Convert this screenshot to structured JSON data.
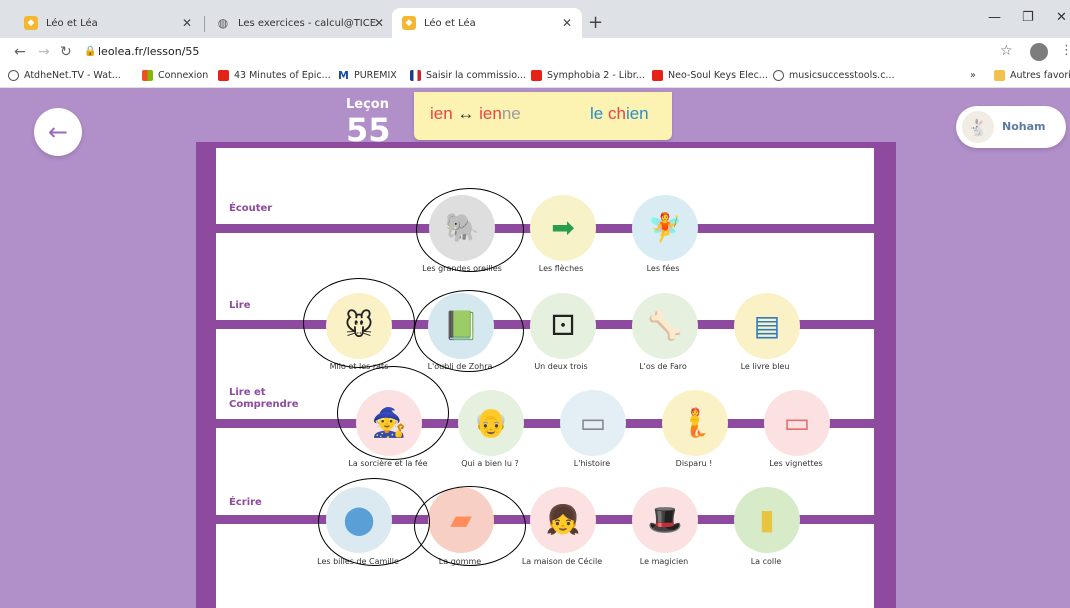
{
  "browser": {
    "tabs": [
      {
        "title": "Léo et Léa",
        "active": false
      },
      {
        "title": "Les exercices - calcul@TICE",
        "active": false
      },
      {
        "title": "Léo et Léa",
        "active": true
      }
    ],
    "new_tab": "+",
    "url": "leolea.fr/lesson/55",
    "bookmarks": [
      {
        "label": "AtdheNet.TV - Wat...",
        "icon": "globe-icon"
      },
      {
        "label": "Connexion",
        "icon": "microsoft-icon"
      },
      {
        "label": "43 Minutes of Epic...",
        "icon": "youtube-icon"
      },
      {
        "label": "PUREMIX",
        "icon": "puremix-icon"
      },
      {
        "label": "Saisir la commissio...",
        "icon": "flag-icon"
      },
      {
        "label": "Symphobia 2 - Libr...",
        "icon": "youtube-icon"
      },
      {
        "label": "Neo-Soul Keys Elec...",
        "icon": "youtube-icon"
      },
      {
        "label": "musicsuccesstools.c...",
        "icon": "globe-icon"
      }
    ],
    "bookmarks_more": "»",
    "other_bookmarks": "Autres favoris"
  },
  "lesson": {
    "label": "Leçon",
    "number": "55",
    "banner": {
      "pattern_red": "ien",
      "arrow": "↔",
      "pattern2_red": "ien",
      "pattern2_grey": "ne",
      "example_blue1": "le ",
      "example_red": "ch",
      "example_blue2": "ien"
    }
  },
  "user": {
    "name": "Noham"
  },
  "sections": [
    {
      "title": "Écouter",
      "items": [
        {
          "label": "Les grandes oreilles",
          "icon": "elephant-icon",
          "bg": "#dedede"
        },
        {
          "label": "Les flèches",
          "icon": "arrow-sign-icon",
          "bg": "#f7f2c8"
        },
        {
          "label": "Les fées",
          "icon": "fairy-icon",
          "bg": "#d9ecf4"
        }
      ]
    },
    {
      "title": "Lire",
      "items": [
        {
          "label": "Milo et les rats",
          "icon": "mouse-icon",
          "bg": "#fbf1c6"
        },
        {
          "label": "L'oubli de Zohra",
          "icon": "girl-reading-icon",
          "bg": "#d5e8f0"
        },
        {
          "label": "Un deux trois",
          "icon": "dice-icon",
          "bg": "#e5f0df"
        },
        {
          "label": "L'os de Faro",
          "icon": "bone-icon",
          "bg": "#e5f0df"
        },
        {
          "label": "Le livre bleu",
          "icon": "blue-book-icon",
          "bg": "#fbf1c6"
        }
      ]
    },
    {
      "title": "Lire et Comprendre",
      "items": [
        {
          "label": "La sorcière et la fée",
          "icon": "witch-icon",
          "bg": "#fbe1e1"
        },
        {
          "label": "Qui a bien lu ?",
          "icon": "old-man-icon",
          "bg": "#e5f0df"
        },
        {
          "label": "L'histoire",
          "icon": "board-icon",
          "bg": "#e3eef5"
        },
        {
          "label": "Disparu !",
          "icon": "mermaid-icon",
          "bg": "#fbf1c6"
        },
        {
          "label": "Les vignettes",
          "icon": "frame-icon",
          "bg": "#fbe1e1"
        }
      ]
    },
    {
      "title": "Écrire",
      "items": [
        {
          "label": "Les billes de Camille",
          "icon": "marbles-icon",
          "bg": "#dbe9f1"
        },
        {
          "label": "La gomme",
          "icon": "eraser-icon",
          "bg": "#f8cfc4"
        },
        {
          "label": "La maison de Cécile",
          "icon": "girl-writing-icon",
          "bg": "#fbe1e1"
        },
        {
          "label": "Le magicien",
          "icon": "magician-icon",
          "bg": "#fbe1e1"
        },
        {
          "label": "La colle",
          "icon": "glue-icon",
          "bg": "#d7ebc9"
        }
      ]
    }
  ]
}
